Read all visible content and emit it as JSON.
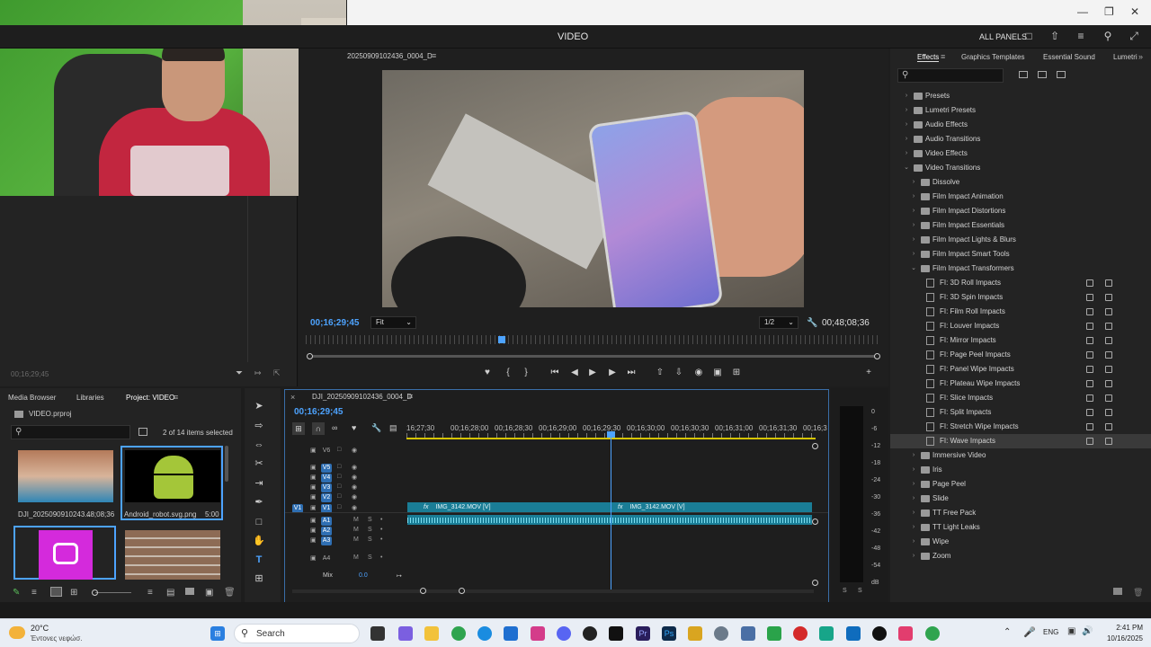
{
  "header": {
    "workspace_title": "VIDEO",
    "all_panels": "ALL PANELS"
  },
  "program_monitor": {
    "tab_title": "20250909102436_0004_D",
    "timecode_current": "00;16;29;45",
    "timecode_duration": "00;48;08;36",
    "zoom": "Fit",
    "resolution": "1/2"
  },
  "source_monitor": {
    "timecode": "00;16;29;45"
  },
  "effects_panel": {
    "tabs": [
      "Effects",
      "Graphics Templates",
      "Essential Sound",
      "Lumetri"
    ],
    "tree": [
      {
        "label": "Presets",
        "level": 0,
        "type": "folder",
        "expanded": false
      },
      {
        "label": "Lumetri Presets",
        "level": 0,
        "type": "folder",
        "expanded": false
      },
      {
        "label": "Audio Effects",
        "level": 0,
        "type": "folder",
        "expanded": false
      },
      {
        "label": "Audio Transitions",
        "level": 0,
        "type": "folder",
        "expanded": false
      },
      {
        "label": "Video Effects",
        "level": 0,
        "type": "folder",
        "expanded": false
      },
      {
        "label": "Video Transitions",
        "level": 0,
        "type": "folder",
        "expanded": true
      },
      {
        "label": "Dissolve",
        "level": 1,
        "type": "folder",
        "expanded": false
      },
      {
        "label": "Film Impact Animation",
        "level": 1,
        "type": "folder",
        "expanded": false
      },
      {
        "label": "Film Impact Distortions",
        "level": 1,
        "type": "folder",
        "expanded": false
      },
      {
        "label": "Film Impact Essentials",
        "level": 1,
        "type": "folder",
        "expanded": false
      },
      {
        "label": "Film Impact Lights & Blurs",
        "level": 1,
        "type": "folder",
        "expanded": false
      },
      {
        "label": "Film Impact Smart Tools",
        "level": 1,
        "type": "folder",
        "expanded": false
      },
      {
        "label": "Film Impact Transformers",
        "level": 1,
        "type": "folder",
        "expanded": true
      },
      {
        "label": "FI: 3D Roll Impacts",
        "level": 2,
        "type": "effect"
      },
      {
        "label": "FI: 3D Spin Impacts",
        "level": 2,
        "type": "effect"
      },
      {
        "label": "FI: Film Roll Impacts",
        "level": 2,
        "type": "effect"
      },
      {
        "label": "FI: Louver Impacts",
        "level": 2,
        "type": "effect"
      },
      {
        "label": "FI: Mirror Impacts",
        "level": 2,
        "type": "effect"
      },
      {
        "label": "FI: Page Peel Impacts",
        "level": 2,
        "type": "effect"
      },
      {
        "label": "FI: Panel Wipe Impacts",
        "level": 2,
        "type": "effect"
      },
      {
        "label": "FI: Plateau Wipe Impacts",
        "level": 2,
        "type": "effect"
      },
      {
        "label": "FI: Slice Impacts",
        "level": 2,
        "type": "effect"
      },
      {
        "label": "FI: Split Impacts",
        "level": 2,
        "type": "effect"
      },
      {
        "label": "FI: Stretch Wipe Impacts",
        "level": 2,
        "type": "effect"
      },
      {
        "label": "FI: Wave Impacts",
        "level": 2,
        "type": "effect",
        "selected": true
      },
      {
        "label": "Immersive Video",
        "level": 1,
        "type": "folder",
        "expanded": false
      },
      {
        "label": "Iris",
        "level": 1,
        "type": "folder",
        "expanded": false
      },
      {
        "label": "Page Peel",
        "level": 1,
        "type": "folder",
        "expanded": false
      },
      {
        "label": "Slide",
        "level": 1,
        "type": "folder",
        "expanded": false
      },
      {
        "label": "TT Free Pack",
        "level": 1,
        "type": "folder",
        "expanded": false
      },
      {
        "label": "TT Light Leaks",
        "level": 1,
        "type": "folder",
        "expanded": false
      },
      {
        "label": "Wipe",
        "level": 1,
        "type": "folder",
        "expanded": false
      },
      {
        "label": "Zoom",
        "level": 1,
        "type": "folder",
        "expanded": false
      }
    ]
  },
  "project_panel": {
    "tabs": [
      "Media Browser",
      "Libraries",
      "Project: VIDEO"
    ],
    "project_file": "VIDEO.prproj",
    "selection_info": "2 of 14 items selected",
    "items": [
      {
        "name": "DJI_2025090910243...",
        "duration": "48;08;36"
      },
      {
        "name": "Android_robot.svg.png",
        "duration": "5:00"
      },
      {
        "name": "",
        "duration": ""
      },
      {
        "name": "",
        "duration": ""
      }
    ]
  },
  "timeline": {
    "tab_title": "DJI_20250909102436_0004_D",
    "timecode": "00;16;29;45",
    "ruler_labels": [
      "16;27;30",
      "00;16;28;00",
      "00;16;28;30",
      "00;16;29;00",
      "00;16;29;30",
      "00;16;30;00",
      "00;16;30;30",
      "00;16;31;00",
      "00;16;31;30",
      "00;16;3"
    ],
    "video_tracks": [
      "V6",
      "V5",
      "V4",
      "V3",
      "V2",
      "V1"
    ],
    "audio_tracks": [
      "A1",
      "A2",
      "A3",
      "A4"
    ],
    "mix_label": "Mix",
    "mix_value": "0.0",
    "clips": {
      "v1_a": "IMG_3142.MOV [V]",
      "v1_b": "IMG_3142.MOV [V]"
    },
    "track_letters": {
      "mute": "M",
      "solo": "S"
    }
  },
  "audio_meter": {
    "db_labels": [
      "0",
      "-6",
      "-12",
      "-18",
      "-24",
      "-30",
      "-36",
      "-42",
      "-48",
      "-54",
      "dB"
    ],
    "solo": [
      "S",
      "S"
    ]
  },
  "taskbar": {
    "weather_temp": "20°C",
    "weather_desc": "Έντονες νεφώσ.",
    "search_label": "Search",
    "lang": "ENG",
    "time": "2:41 PM",
    "date": "10/16/2025"
  },
  "colors": {
    "accent_blue": "#4da3ff",
    "clip_teal": "#1a7d96",
    "track_active": "#2f6fb3",
    "workarea_yellow": "#d6c400"
  }
}
